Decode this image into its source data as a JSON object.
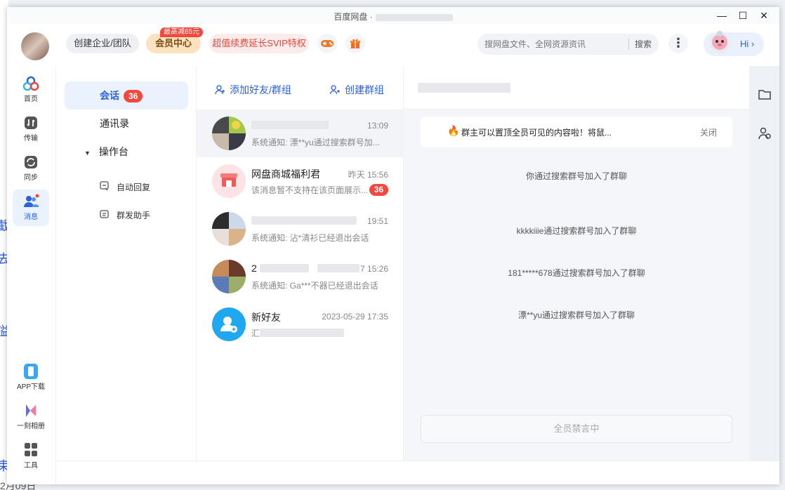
{
  "window": {
    "title": "百度网盘 ·"
  },
  "background": {
    "bottom_text": "2月09日"
  },
  "topbar": {
    "team_button": "创建企业/团队",
    "vip_button": "会员中心",
    "vip_badge": "最高减65元",
    "svip_button": "超值续费延长SVIP特权",
    "search_placeholder": "搜网盘文件、全网资源资讯",
    "search_button": "搜索",
    "user_greeting": "Hi ›"
  },
  "rail": {
    "items": [
      {
        "label": "首页"
      },
      {
        "label": "传输"
      },
      {
        "label": "同步"
      },
      {
        "label": "消息"
      }
    ],
    "bottom_items": [
      {
        "label": "APP下载"
      },
      {
        "label": "一刻相册"
      },
      {
        "label": "工具"
      }
    ]
  },
  "nav": {
    "chat_label": "会话",
    "chat_badge": "36",
    "contacts_label": "通讯录",
    "console_label": "操作台",
    "auto_reply_label": "自动回复",
    "mass_send_label": "群发助手"
  },
  "conversations": {
    "add_friend_label": "添加好友/群组",
    "create_group_label": "创建群组",
    "items": [
      {
        "name": "",
        "time": "13:09",
        "message": "系统通知: 漂**yu通过搜索群号加...",
        "badge": ""
      },
      {
        "name": "网盘商城福利君",
        "time": "昨天 15:56",
        "message": "该消息暂不支持在该页面展示...",
        "badge": "36"
      },
      {
        "name": "",
        "time": "19:51",
        "message": "系统通知: 沾*清衫已经退出会话",
        "badge": ""
      },
      {
        "name": "2",
        "time": "7 15:26",
        "message": "系统通知: Ga***不器已经退出会话",
        "badge": ""
      },
      {
        "name": "新好友",
        "time": "2023-05-29 17:35",
        "message": "汇",
        "badge": ""
      }
    ]
  },
  "chat": {
    "pinned_text": "群主可以置顶全员可见的内容啦！将鼠...",
    "pinned_close": "关闭",
    "system_messages": [
      "你通过搜索群号加入了群聊",
      "kkkkiiie通过搜索群号加入了群聊",
      "181*****678通过搜索群号加入了群聊",
      "漂**yu通过搜索群号加入了群聊"
    ],
    "mute_label": "全员禁言中"
  }
}
